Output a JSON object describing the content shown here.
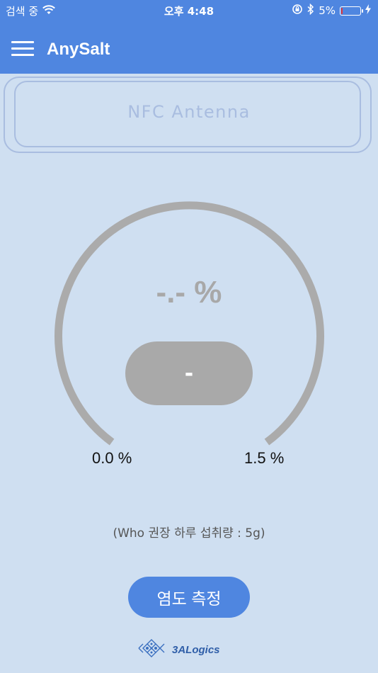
{
  "status_bar": {
    "left_text": "검색 중",
    "time": "오후 4:48",
    "battery_percent": "5%",
    "battery_level": 0.05,
    "icons": [
      "wifi-icon",
      "rotation-lock-icon",
      "bluetooth-icon",
      "battery-icon",
      "charging-icon"
    ]
  },
  "app_bar": {
    "title": "AnySalt",
    "menu_icon": "hamburger-menu-icon"
  },
  "nfc": {
    "label": "NFC Antenna"
  },
  "gauge": {
    "value": "-.- %",
    "status": "-",
    "min_label": "0.0 %",
    "max_label": "1.5 %",
    "min": 0.0,
    "max": 1.5,
    "color": "#ababab"
  },
  "note": "(Who 권장 하루 섭취량 : 5g)",
  "measure_button": {
    "label": "염도 측정"
  },
  "footer": {
    "logo_text": "3ALogics"
  },
  "colors": {
    "primary": "#4f86e0",
    "background": "#cfdff1",
    "nfc_outline": "#a9bde0",
    "gauge_grey": "#ababab"
  }
}
